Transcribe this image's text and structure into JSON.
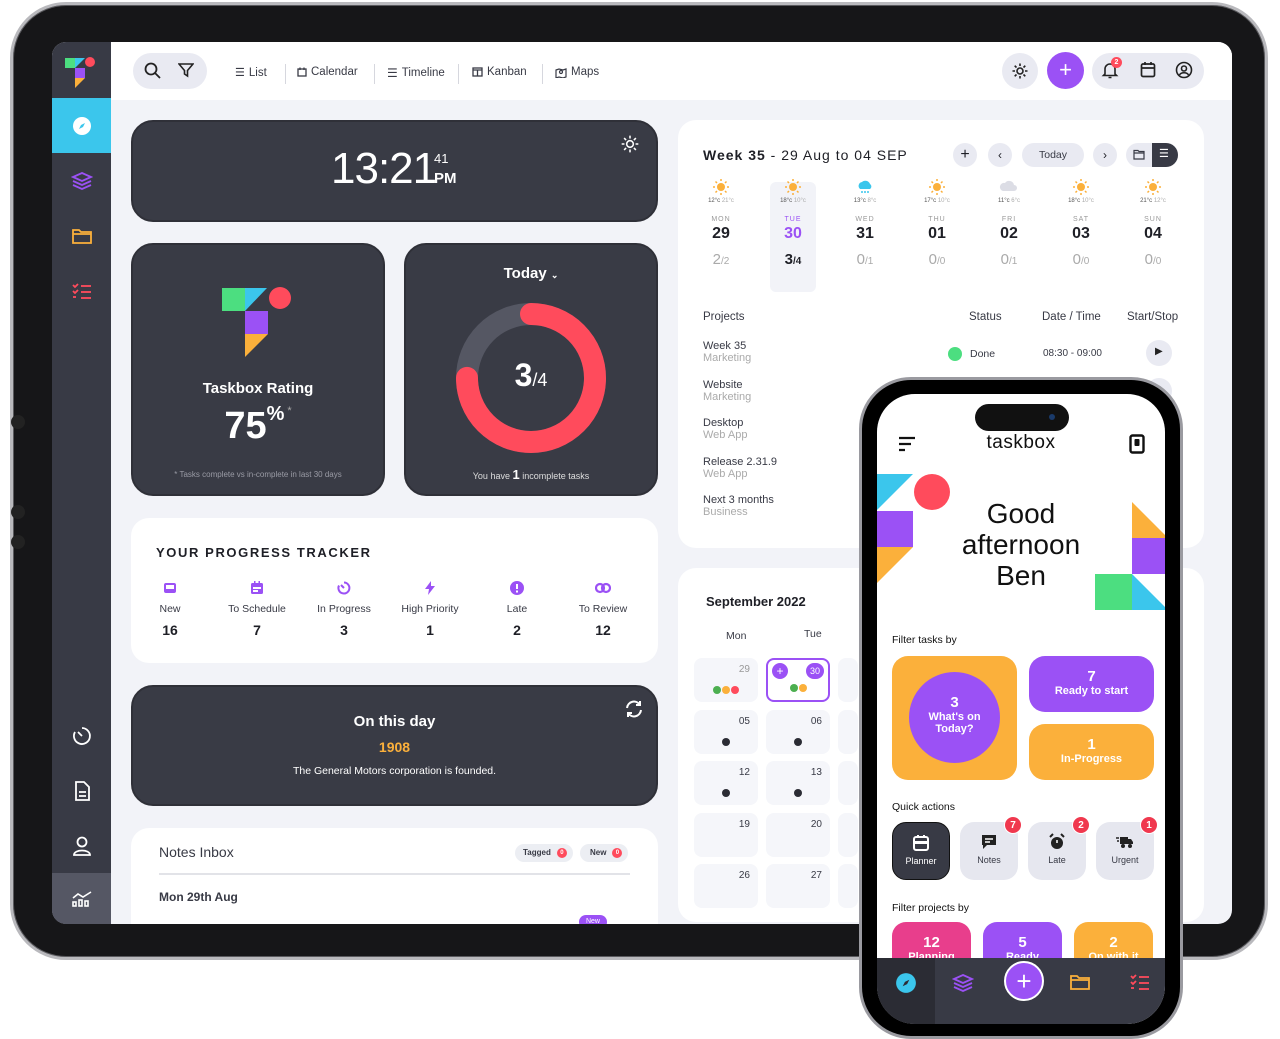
{
  "topbar": {
    "views": [
      {
        "icon": "list-icon",
        "label": "List"
      },
      {
        "icon": "calendar-icon",
        "label": "Calendar"
      },
      {
        "icon": "timeline-icon",
        "label": "Timeline"
      },
      {
        "icon": "kanban-icon",
        "label": "Kanban"
      },
      {
        "icon": "map-icon",
        "label": "Maps"
      }
    ],
    "notification_count": "2"
  },
  "sidebar": {
    "items": [
      {
        "icon": "compass-icon",
        "active": true
      },
      {
        "icon": "layers-icon"
      },
      {
        "icon": "folder-icon"
      },
      {
        "icon": "checklist-icon"
      }
    ],
    "bottom_items": [
      {
        "icon": "timer-icon"
      },
      {
        "icon": "document-icon"
      },
      {
        "icon": "user-icon"
      },
      {
        "icon": "analytics-icon"
      }
    ]
  },
  "clock": {
    "time": "13:21",
    "seconds": "41",
    "period": "PM"
  },
  "rating": {
    "title": "Taskbox Rating",
    "value": "75",
    "unit": "%",
    "asterisk": "*",
    "footnote": "* Tasks complete vs in-complete in last 30 days"
  },
  "today": {
    "label": "Today",
    "done": "3",
    "total": "/4",
    "progress_fraction": 0.75,
    "footer_pre": "You have ",
    "footer_count": "1",
    "footer_post": " incomplete tasks"
  },
  "progress_tracker": {
    "title": "YOUR PROGRESS TRACKER",
    "items": [
      {
        "icon": "inbox-icon",
        "label": "New",
        "value": "16"
      },
      {
        "icon": "calendar-icon",
        "label": "To Schedule",
        "value": "7"
      },
      {
        "icon": "timer-icon",
        "label": "In Progress",
        "value": "3"
      },
      {
        "icon": "bolt-icon",
        "label": "High Priority",
        "value": "1"
      },
      {
        "icon": "alert-icon",
        "label": "Late",
        "value": "2"
      },
      {
        "icon": "review-icon",
        "label": "To Review",
        "value": "12"
      }
    ]
  },
  "on_this_day": {
    "title": "On this day",
    "year": "1908",
    "text": "The General Motors corporation is founded."
  },
  "notes": {
    "title": "Notes Inbox",
    "tag1": "Tagged",
    "tag1_count": "0",
    "tag2": "New",
    "tag2_count": "0",
    "date": "Mon 29th Aug",
    "item_badge": "New"
  },
  "week": {
    "title_bold": "Week 35",
    "title_rest": " - 29 Aug to 04 SEP",
    "today_button": "Today",
    "days": [
      {
        "weather": "sun",
        "hi": "12°c",
        "lo": "21°c",
        "name": "MON",
        "num": "29",
        "done": "2",
        "total": "/2"
      },
      {
        "weather": "sun",
        "hi": "18°c",
        "lo": "10°c",
        "name": "TUE",
        "num": "30",
        "done": "3",
        "total": "/4",
        "current": true
      },
      {
        "weather": "rain",
        "hi": "13°c",
        "lo": "8°c",
        "name": "WED",
        "num": "31",
        "done": "0",
        "total": "/1"
      },
      {
        "weather": "sun",
        "hi": "17°c",
        "lo": "10°c",
        "name": "THU",
        "num": "01",
        "done": "0",
        "total": "/0"
      },
      {
        "weather": "cloud",
        "hi": "11°c",
        "lo": "6°c",
        "name": "FRI",
        "num": "02",
        "done": "0",
        "total": "/1"
      },
      {
        "weather": "sun",
        "hi": "18°c",
        "lo": "10°c",
        "name": "SAT",
        "num": "03",
        "done": "0",
        "total": "/0"
      },
      {
        "weather": "sun",
        "hi": "21°c",
        "lo": "12°c",
        "name": "SUN",
        "num": "04",
        "done": "0",
        "total": "/0"
      }
    ],
    "table_headers": {
      "projects": "Projects",
      "status": "Status",
      "datetime": "Date / Time",
      "startstop": "Start/Stop"
    },
    "projects": [
      {
        "name": "Week 35",
        "sub": "Marketing",
        "status": "Done",
        "time": "08:30 - 09:00"
      },
      {
        "name": "Website",
        "sub": "Marketing"
      },
      {
        "name": "Desktop",
        "sub": "Web App"
      },
      {
        "name": "Release 2.31.9",
        "sub": "Web App"
      },
      {
        "name": "Next 3 months",
        "sub": "Business"
      }
    ]
  },
  "month": {
    "title": "September 2022",
    "weekdays": [
      "Mon",
      "Tue"
    ],
    "rows": [
      [
        "29",
        "30"
      ],
      [
        "05",
        "06"
      ],
      [
        "12",
        "13"
      ],
      [
        "19",
        "20"
      ],
      [
        "26",
        "27"
      ]
    ]
  },
  "phone": {
    "app_name": "taskbox",
    "greeting_1": "Good",
    "greeting_2": "afternoon",
    "greeting_3": "Ben",
    "filter_tasks_label": "Filter tasks by",
    "today_count": "3",
    "today_label_1": "What's on",
    "today_label_2": "Today?",
    "ready_count": "7",
    "ready_label": "Ready to start",
    "inprogress_count": "1",
    "inprogress_label": "In-Progress",
    "quick_actions_label": "Quick actions",
    "quick_actions": [
      {
        "icon": "planner-icon",
        "label": "Planner"
      },
      {
        "icon": "notes-icon",
        "label": "Notes",
        "badge": "7"
      },
      {
        "icon": "alarm-icon",
        "label": "Late",
        "badge": "2"
      },
      {
        "icon": "truck-icon",
        "label": "Urgent",
        "badge": "1"
      }
    ],
    "filter_projects_label": "Filter projects by",
    "projects": [
      {
        "count": "12",
        "label": "Planning",
        "color": "#e83e8c"
      },
      {
        "count": "5",
        "label": "Ready",
        "color": "#9b51f5"
      },
      {
        "count": "2",
        "label": "On with it",
        "color": "#fbb03b"
      }
    ]
  },
  "colors": {
    "accent": "#9b51f5",
    "red": "#ff4b5c",
    "cyan": "#3bc6ec",
    "orange": "#fbb03b",
    "green": "#4cde80",
    "dark": "#383a45"
  }
}
